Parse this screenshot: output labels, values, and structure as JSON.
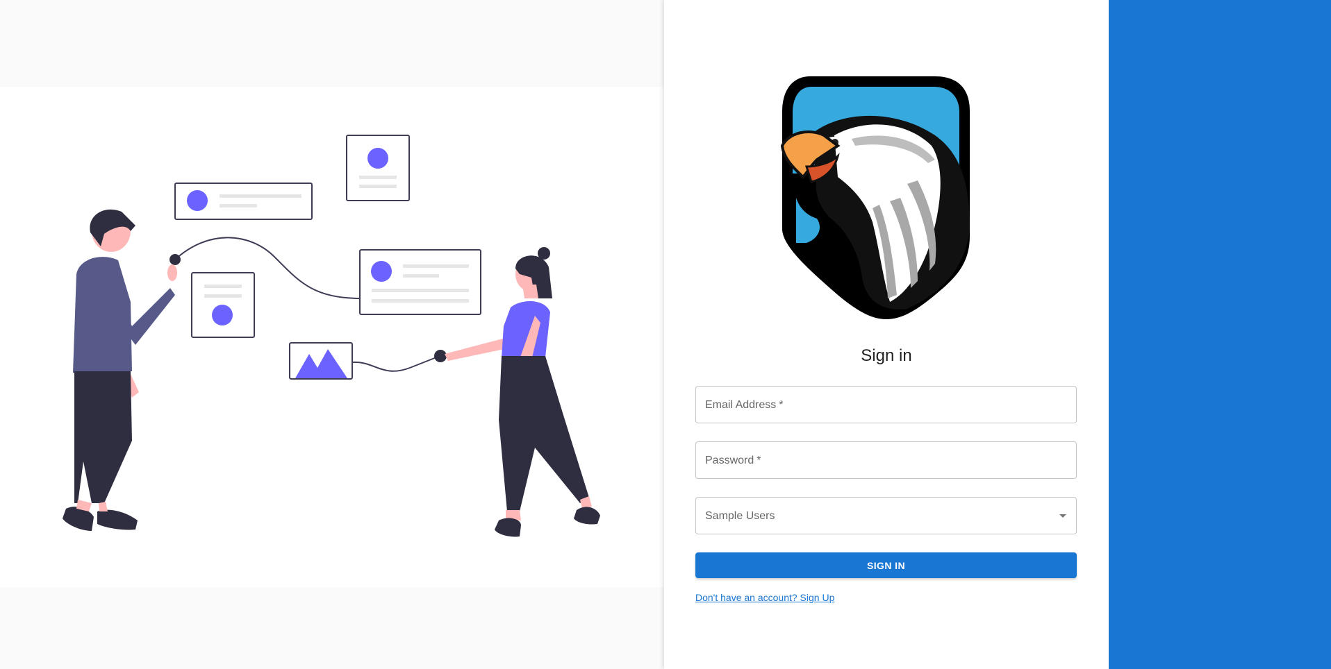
{
  "signin": {
    "title": "Sign in",
    "email_label": "Email Address",
    "password_label": "Password",
    "required_mark": "*",
    "sample_users_label": "Sample Users",
    "submit_label": "SIGN IN",
    "signup_link": "Don't have an account? Sign Up"
  },
  "colors": {
    "primary": "#1976d2",
    "illustration_accent": "#6c63ff",
    "dark": "#2f2e41"
  },
  "icons": {
    "logo": "eagle-shield-logo",
    "dropdown": "caret-down-icon"
  }
}
